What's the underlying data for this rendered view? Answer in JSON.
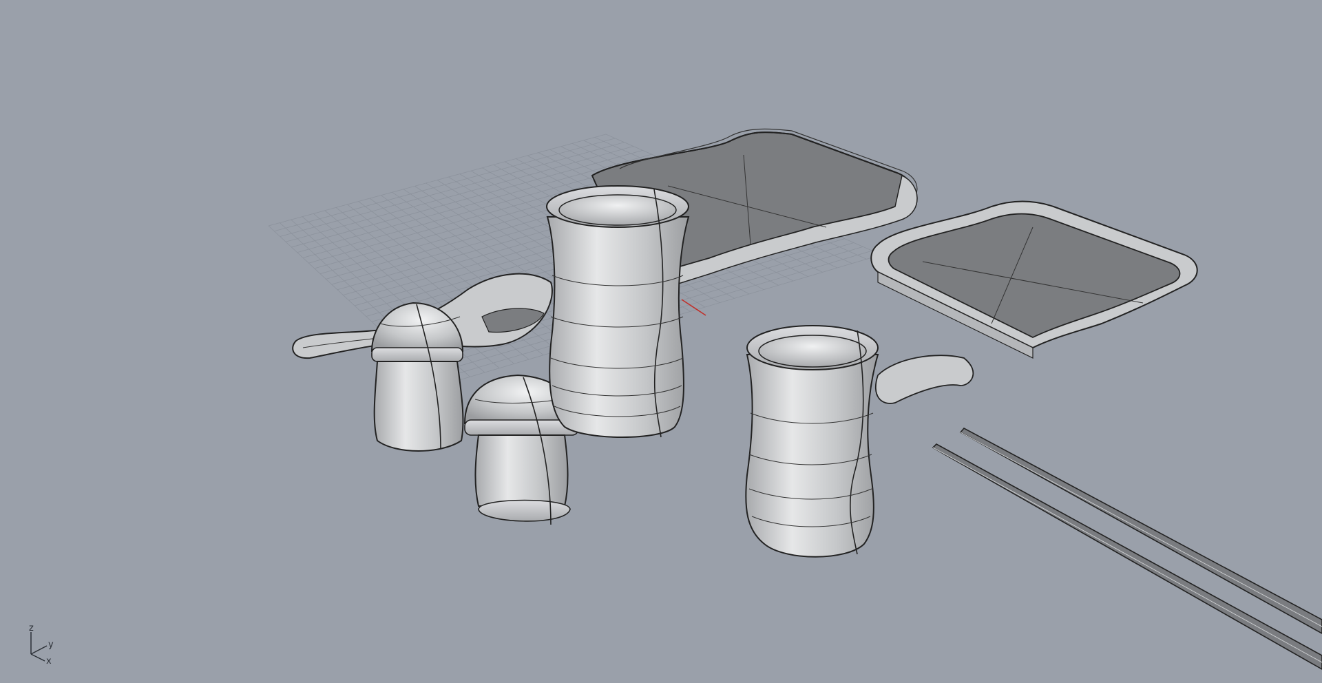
{
  "viewport": {
    "background_color": "#9aa0aa",
    "view": "perspective",
    "display_mode": "shaded",
    "grid_visible": true
  },
  "axis_indicator": {
    "z_label": "z",
    "y_label": "y",
    "x_label": "x"
  },
  "colors": {
    "object_fill": "#c9cbcd",
    "object_dark": "#6f7276",
    "tray_inner": "#7b7d80",
    "edge": "#222222",
    "isocurve": "#3a3a3a",
    "grid_line": "#8c929c",
    "x_axis": "#c0302a"
  },
  "objects": [
    {
      "name": "large-tray"
    },
    {
      "name": "small-tray"
    },
    {
      "name": "tall-cup"
    },
    {
      "name": "mug-with-handle"
    },
    {
      "name": "salt-shaker"
    },
    {
      "name": "pepper-shaker"
    },
    {
      "name": "spoon"
    },
    {
      "name": "chopsticks"
    }
  ]
}
